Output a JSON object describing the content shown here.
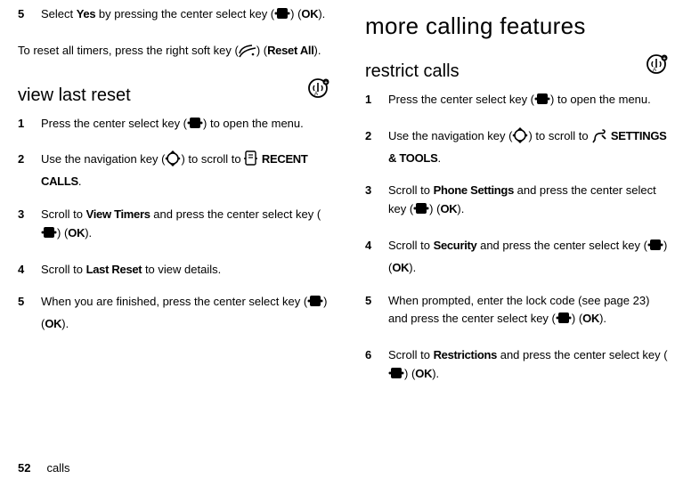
{
  "left": {
    "step5_pre": "Select ",
    "step5_yes": "Yes",
    "step5_post1": " by pressing the center select key (",
    "step5_post2": ") (",
    "step5_ok": "OK",
    "step5_post3": ").",
    "reset_para_pre": "To reset all timers, press the right soft key (",
    "reset_para_mid": ") (",
    "reset_all": "Reset All",
    "reset_para_end": ").",
    "h2_view": "view last reset",
    "step1_pre": "Press the center select key (",
    "step1_post": ") to open the menu.",
    "step2_pre": "Use the navigation key (",
    "step2_mid": ") to scroll to ",
    "step2_post": "",
    "recent_calls": "RECENT CALLS",
    "recent_calls_period": ".",
    "step3_pre": "Scroll to ",
    "view_timers": "View Timers",
    "step3_mid": " and press the center select key (",
    "step3_post": ") (",
    "step3_ok": "OK",
    "step3_end": ").",
    "step4_pre": "Scroll to ",
    "last_reset": "Last Reset",
    "step4_post": " to view details.",
    "step5b_pre": "When you are finished, press the center select key (",
    "step5b_mid": ") (",
    "step5b_ok": "OK",
    "step5b_end": ")."
  },
  "right": {
    "h1": "more calling features",
    "h2_restrict": "restrict calls",
    "step1_pre": "Press the center select key (",
    "step1_post": ") to open the menu.",
    "step2_pre": "Use the navigation key (",
    "step2_mid": ") to scroll to ",
    "settings_tools": "SETTINGS & TOOLS",
    "settings_tools_period": ".",
    "step3_pre": "Scroll to ",
    "phone_settings": "Phone Settings",
    "step3_mid": " and press the center select key (",
    "step3_post": ") (",
    "step3_ok": "OK",
    "step3_end": ").",
    "step4_pre": "Scroll to ",
    "security": "Security",
    "step4_mid": " and press the center select key (",
    "step4_post": ") (",
    "step4_ok": "OK",
    "step4_end": ").",
    "step5_pre": "When prompted, enter the lock code (see page 23) and press the center select key (",
    "step5_mid": ") (",
    "step5_ok": "OK",
    "step5_end": ").",
    "step6_pre": "Scroll to ",
    "restrictions": "Restrictions",
    "step6_mid": " and press the center select key (",
    "step6_post": ") (",
    "step6_ok": "OK",
    "step6_end": ")."
  },
  "nums": {
    "n1": "1",
    "n2": "2",
    "n3": "3",
    "n4": "4",
    "n5": "5",
    "n6": "6"
  },
  "footer": {
    "page": "52",
    "section": "calls"
  }
}
